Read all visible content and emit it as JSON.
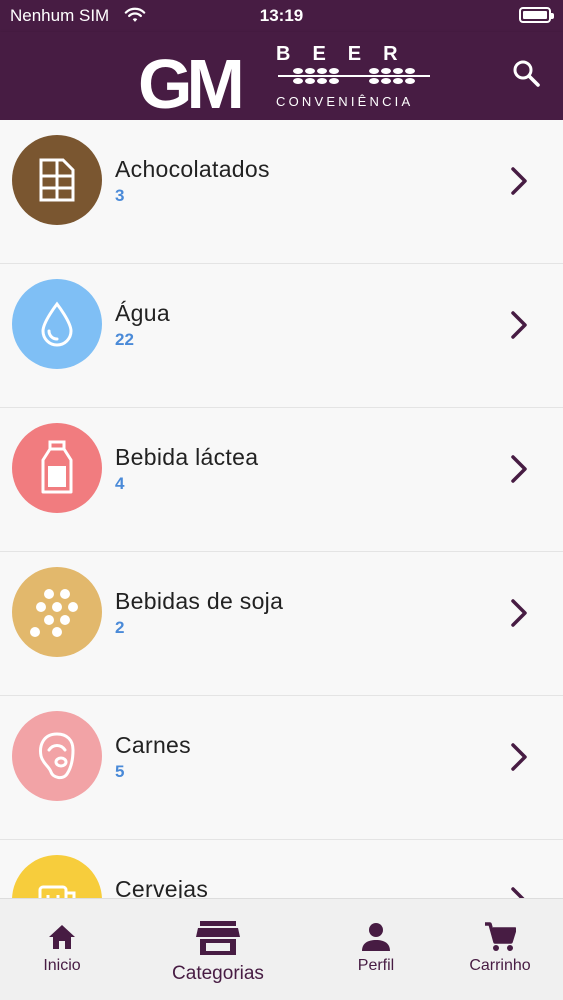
{
  "status_bar": {
    "carrier": "Nenhum SIM",
    "time": "13:19"
  },
  "header": {
    "logo_monogram": "GM",
    "logo_top": "BEER",
    "logo_bottom": "CONVENIÊNCIA",
    "brand_color": "#471c43"
  },
  "categories": [
    {
      "name": "Achocolatados",
      "count": "3",
      "color": "#7a5630",
      "icon": "chocolate-bar-icon"
    },
    {
      "name": "Água",
      "count": "22",
      "color": "#7fbff5",
      "icon": "water-drop-icon"
    },
    {
      "name": "Bebida láctea",
      "count": "4",
      "color": "#f17c7f",
      "icon": "milk-bottle-icon"
    },
    {
      "name": "Bebidas de soja",
      "count": "2",
      "color": "#e2b86c",
      "icon": "soy-beans-icon"
    },
    {
      "name": "Carnes",
      "count": "5",
      "color": "#f2a3a6",
      "icon": "meat-icon"
    },
    {
      "name": "Cervejas",
      "count": "",
      "color": "#f7cd3c",
      "icon": "beer-mug-icon"
    }
  ],
  "tabs": [
    {
      "label": "Inicio",
      "icon": "home-icon"
    },
    {
      "label": "Categorias",
      "icon": "store-icon",
      "active": true
    },
    {
      "label": "Perfil",
      "icon": "person-icon"
    },
    {
      "label": "Carrinho",
      "icon": "cart-icon"
    }
  ]
}
